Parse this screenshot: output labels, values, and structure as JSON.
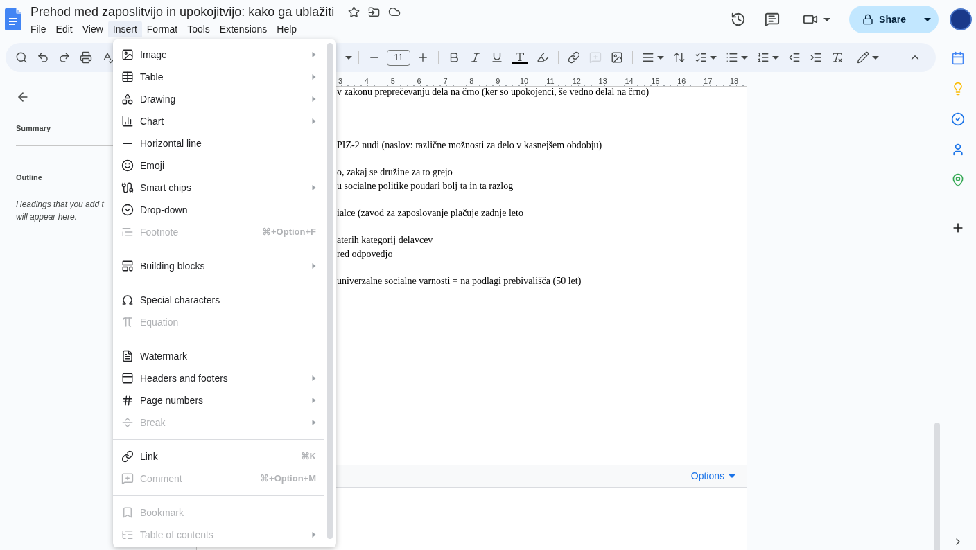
{
  "document": {
    "title": "Prehod med zaposlitvijo in upokojitvijo: kako ga ublažiti"
  },
  "menu_bar": [
    {
      "label": "File",
      "selected": false
    },
    {
      "label": "Edit",
      "selected": false
    },
    {
      "label": "View",
      "selected": false
    },
    {
      "label": "Insert",
      "selected": true
    },
    {
      "label": "Format",
      "selected": false
    },
    {
      "label": "Tools",
      "selected": false
    },
    {
      "label": "Extensions",
      "selected": false
    },
    {
      "label": "Help",
      "selected": false
    }
  ],
  "share_button": {
    "label": "Share"
  },
  "toolbar": {
    "font_size": "11"
  },
  "ruler": {
    "numbers": [
      "3",
      "4",
      "5",
      "6",
      "7",
      "8",
      "9",
      "10",
      "11",
      "12",
      "13",
      "14",
      "15",
      "16",
      "17",
      "18"
    ]
  },
  "outline_panel": {
    "summary": "Summary",
    "outline": "Outline",
    "hint_lines": [
      "Headings that you add t",
      "will appear here."
    ]
  },
  "document_paragraphs": [
    [
      "v zakonu preprečevanju dela na črno (ker so upokojenci, še vedno delal na črno)"
    ],
    [
      "PIZ-2 nudi (naslov: različne možnosti za delo v kasnejšem obdobju)"
    ],
    [
      "o, zakaj se družine za to grejo",
      "u socialne politike poudari bolj ta in ta razlog"
    ],
    [
      "ialce (zavod za zaposlovanje plačuje zadnje leto"
    ],
    [
      "aterih kategorij delavcev",
      "red odpovedjo"
    ],
    [
      "univerzalne socialne varnosti = na podlagi prebivališča (50 let)"
    ]
  ],
  "options_bar": {
    "label": "Options"
  },
  "insert_menu": [
    [
      {
        "label": "Image",
        "disabled": false,
        "submenu": true
      },
      {
        "label": "Table",
        "disabled": false,
        "submenu": true
      },
      {
        "label": "Drawing",
        "disabled": false,
        "submenu": true
      },
      {
        "label": "Chart",
        "disabled": false,
        "submenu": true
      },
      {
        "label": "Horizontal line",
        "disabled": false,
        "submenu": false
      },
      {
        "label": "Emoji",
        "disabled": false,
        "submenu": false
      },
      {
        "label": "Smart chips",
        "disabled": false,
        "submenu": true
      },
      {
        "label": "Drop-down",
        "disabled": false,
        "submenu": false
      },
      {
        "label": "Footnote",
        "disabled": true,
        "submenu": false,
        "shortcut": "⌘+Option+F"
      }
    ],
    [
      {
        "label": "Building blocks",
        "disabled": false,
        "submenu": true
      }
    ],
    [
      {
        "label": "Special characters",
        "disabled": false,
        "submenu": false
      },
      {
        "label": "Equation",
        "disabled": true,
        "submenu": false
      }
    ],
    [
      {
        "label": "Watermark",
        "disabled": false,
        "submenu": false
      },
      {
        "label": "Headers and footers",
        "disabled": false,
        "submenu": true
      },
      {
        "label": "Page numbers",
        "disabled": false,
        "submenu": true
      },
      {
        "label": "Break",
        "disabled": true,
        "submenu": true
      }
    ],
    [
      {
        "label": "Link",
        "disabled": false,
        "submenu": false,
        "shortcut": "⌘K"
      },
      {
        "label": "Comment",
        "disabled": true,
        "submenu": false,
        "shortcut": "⌘+Option+M"
      }
    ],
    [
      {
        "label": "Bookmark",
        "disabled": true,
        "submenu": false
      },
      {
        "label": "Table of contents",
        "disabled": true,
        "submenu": true
      }
    ]
  ]
}
